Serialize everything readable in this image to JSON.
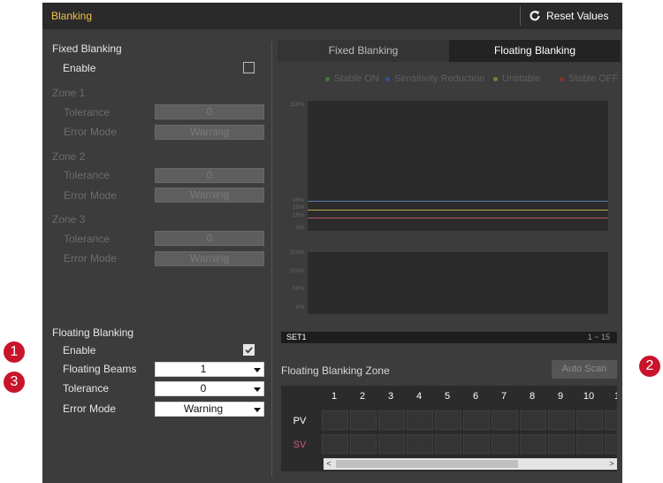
{
  "window": {
    "title": "Blanking",
    "reset_label": "Reset Values"
  },
  "fixed_blanking": {
    "title": "Fixed Blanking",
    "enable_label": "Enable",
    "enabled": false,
    "zones": [
      {
        "label": "Zone 1",
        "tolerance_label": "Tolerance",
        "tolerance_value": "0",
        "error_mode_label": "Error Mode",
        "error_mode_value": "Warning"
      },
      {
        "label": "Zone 2",
        "tolerance_label": "Tolerance",
        "tolerance_value": "0",
        "error_mode_label": "Error Mode",
        "error_mode_value": "Warning"
      },
      {
        "label": "Zone 3",
        "tolerance_label": "Tolerance",
        "tolerance_value": "0",
        "error_mode_label": "Error Mode",
        "error_mode_value": "Warning"
      }
    ]
  },
  "floating_blanking": {
    "title": "Floating Blanking",
    "enable_label": "Enable",
    "enabled": true,
    "beams_label": "Floating Beams",
    "beams_value": "1",
    "tolerance_label": "Tolerance",
    "tolerance_value": "0",
    "error_mode_label": "Error Mode",
    "error_mode_value": "Warning"
  },
  "tabs": [
    {
      "label": "Fixed Blanking",
      "active": false
    },
    {
      "label": "Floating Blanking",
      "active": true
    }
  ],
  "legend": [
    {
      "label": "Stable ON",
      "color": "#3f7d35"
    },
    {
      "label": "Sensitivity Reduction",
      "color": "#3c4f8f"
    },
    {
      "label": "Unstable",
      "color": "#8c7a26"
    },
    {
      "label": "Stable OFF",
      "color": "#8a3325"
    }
  ],
  "chart_top": {
    "ticks": [
      "150%",
      "35%",
      "25%",
      "15%",
      "0%"
    ],
    "lines": [
      {
        "value": 35,
        "color": "#5c7fb0"
      },
      {
        "value": 25,
        "color": "#b8a846"
      },
      {
        "value": 15,
        "color": "#b35a66"
      }
    ]
  },
  "chart_bottom": {
    "ticks": [
      "150%",
      "100%",
      "50%",
      "0%"
    ]
  },
  "set_bar": {
    "label": "SET1",
    "range": "1 ~ 15"
  },
  "zone_section": {
    "title": "Floating Blanking Zone",
    "auto_scan_label": "Auto Scan",
    "columns": [
      "1",
      "2",
      "3",
      "4",
      "5",
      "6",
      "7",
      "8",
      "9",
      "10",
      "1"
    ],
    "rows": [
      {
        "label": "PV",
        "color": "#ffffff"
      },
      {
        "label": "SV",
        "color": "#c85a86"
      }
    ]
  },
  "scrollbar": {
    "left_arrow": "<",
    "right_arrow": ">"
  },
  "callouts": [
    "1",
    "2",
    "3"
  ]
}
